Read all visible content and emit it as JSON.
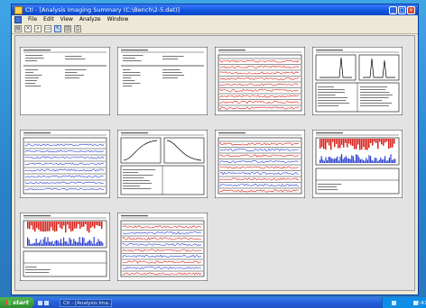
{
  "window": {
    "title": "Ctl - [Analysis Imaging Summary (C:\\Bench\\2-5.dat)]",
    "menu": [
      "File",
      "Edit",
      "View",
      "Analyze",
      "Window"
    ]
  },
  "toolbar": {
    "buttons": [
      "open-icon",
      "close-icon",
      "zoom-icon",
      "page-icon",
      "pointer-icon",
      "chart-icon",
      "print-icon"
    ]
  },
  "pages": [
    {
      "name": "report-page-1",
      "kind": "text"
    },
    {
      "name": "report-page-2",
      "kind": "text"
    },
    {
      "name": "report-page-3",
      "kind": "redlines"
    },
    {
      "name": "report-page-4",
      "kind": "peaks"
    },
    {
      "name": "report-page-5",
      "kind": "bluelines"
    },
    {
      "name": "report-page-6",
      "kind": "curves"
    },
    {
      "name": "report-page-7",
      "kind": "mixedlines"
    },
    {
      "name": "report-page-8",
      "kind": "histogram"
    },
    {
      "name": "report-page-9",
      "kind": "histogram2"
    },
    {
      "name": "report-page-10",
      "kind": "mixedlines2"
    }
  ],
  "taskbar": {
    "start_label": "start",
    "task_item": "Ctl - [Analysis Ima...",
    "clock": "12:47"
  },
  "colors": {
    "title_bar": "#1256dc",
    "trace_red": "#d8211b",
    "trace_blue": "#2b3fd0"
  }
}
